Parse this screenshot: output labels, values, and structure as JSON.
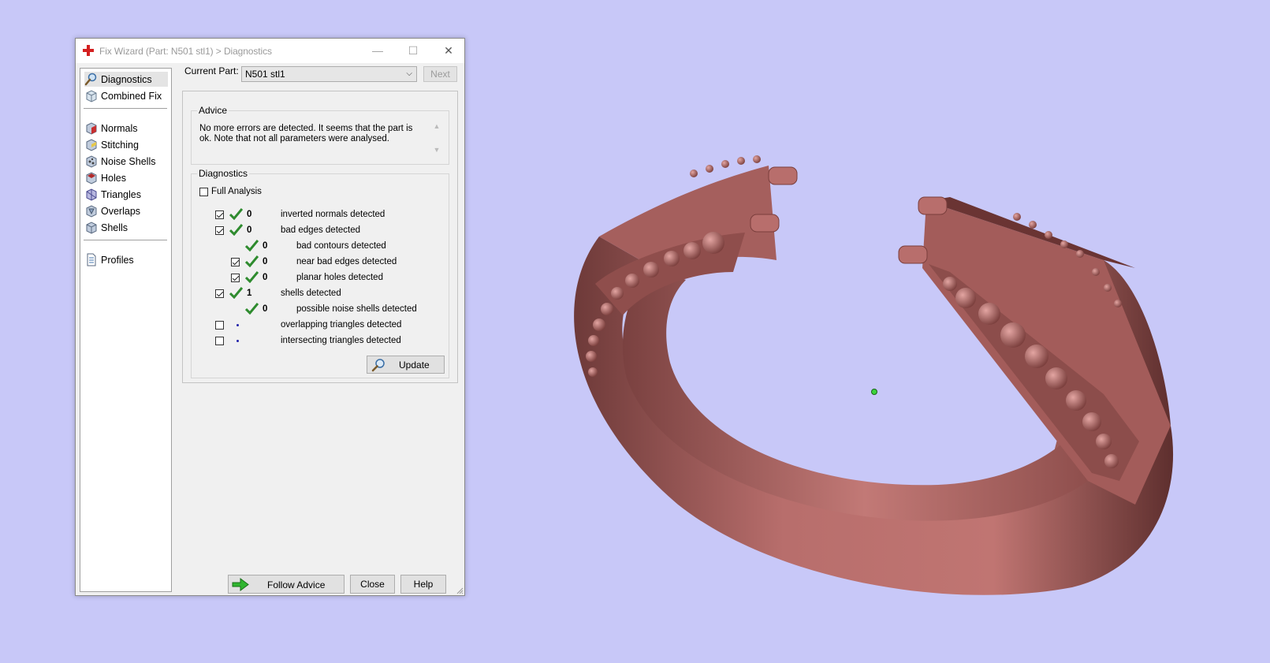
{
  "window": {
    "title": "Fix Wizard (Part: N501 stl1) > Diagnostics",
    "controls": {
      "minimize": "—",
      "maximize": "☐",
      "close": "✕"
    }
  },
  "sidebar": {
    "items": [
      {
        "label": "Diagnostics",
        "icon": "magnifier-icon",
        "selected": true
      },
      {
        "label": "Combined Fix",
        "icon": "cube-icon"
      },
      {
        "label": "Normals",
        "icon": "normals-cube-icon"
      },
      {
        "label": "Stitching",
        "icon": "stitching-cube-icon"
      },
      {
        "label": "Noise Shells",
        "icon": "noise-shells-icon"
      },
      {
        "label": "Holes",
        "icon": "holes-cube-icon"
      },
      {
        "label": "Triangles",
        "icon": "triangles-cube-icon"
      },
      {
        "label": "Overlaps",
        "icon": "overlaps-cube-icon"
      },
      {
        "label": "Shells",
        "icon": "shells-cube-icon"
      },
      {
        "label": "Profiles",
        "icon": "document-icon"
      }
    ]
  },
  "current_part": {
    "label": "Current Part:",
    "value": "N501 stl1"
  },
  "next_label": "Next",
  "advice": {
    "title": "Advice",
    "text": "No more errors are detected. It seems that the part is ok. Note that not all parameters were analysed."
  },
  "diagnostics": {
    "title": "Diagnostics",
    "full_analysis": {
      "label": "Full Analysis",
      "checked": false
    },
    "rows": [
      {
        "checkbox": true,
        "checked": true,
        "status": "ok",
        "count": "0",
        "label": "inverted normals detected",
        "indent": 0
      },
      {
        "checkbox": true,
        "checked": true,
        "status": "ok",
        "count": "0",
        "label": "bad edges detected",
        "indent": 0
      },
      {
        "checkbox": false,
        "checked": false,
        "status": "ok",
        "count": "0",
        "label": "bad contours detected",
        "indent": 1
      },
      {
        "checkbox": true,
        "checked": true,
        "status": "ok",
        "count": "0",
        "label": "near bad edges detected",
        "indent": 1
      },
      {
        "checkbox": true,
        "checked": true,
        "status": "ok",
        "count": "0",
        "label": "planar holes detected",
        "indent": 1
      },
      {
        "checkbox": true,
        "checked": true,
        "status": "ok",
        "count": "1",
        "label": "shells detected",
        "indent": 0
      },
      {
        "checkbox": false,
        "checked": false,
        "status": "ok",
        "count": "0",
        "label": "possible noise shells detected",
        "indent": 1
      },
      {
        "checkbox": true,
        "checked": false,
        "status": "pending",
        "count": "",
        "label": "overlapping triangles detected",
        "indent": 0
      },
      {
        "checkbox": true,
        "checked": false,
        "status": "pending",
        "count": "",
        "label": "intersecting triangles detected",
        "indent": 0
      }
    ],
    "update_label": "Update"
  },
  "buttons": {
    "follow_advice": "Follow Advice",
    "close": "Close",
    "help": "Help"
  },
  "colors": {
    "viewport_bg": "#c8c8f8",
    "model": "#b86e6c",
    "check_green": "#2e8b2e",
    "arrow_green": "#2fb52f"
  }
}
